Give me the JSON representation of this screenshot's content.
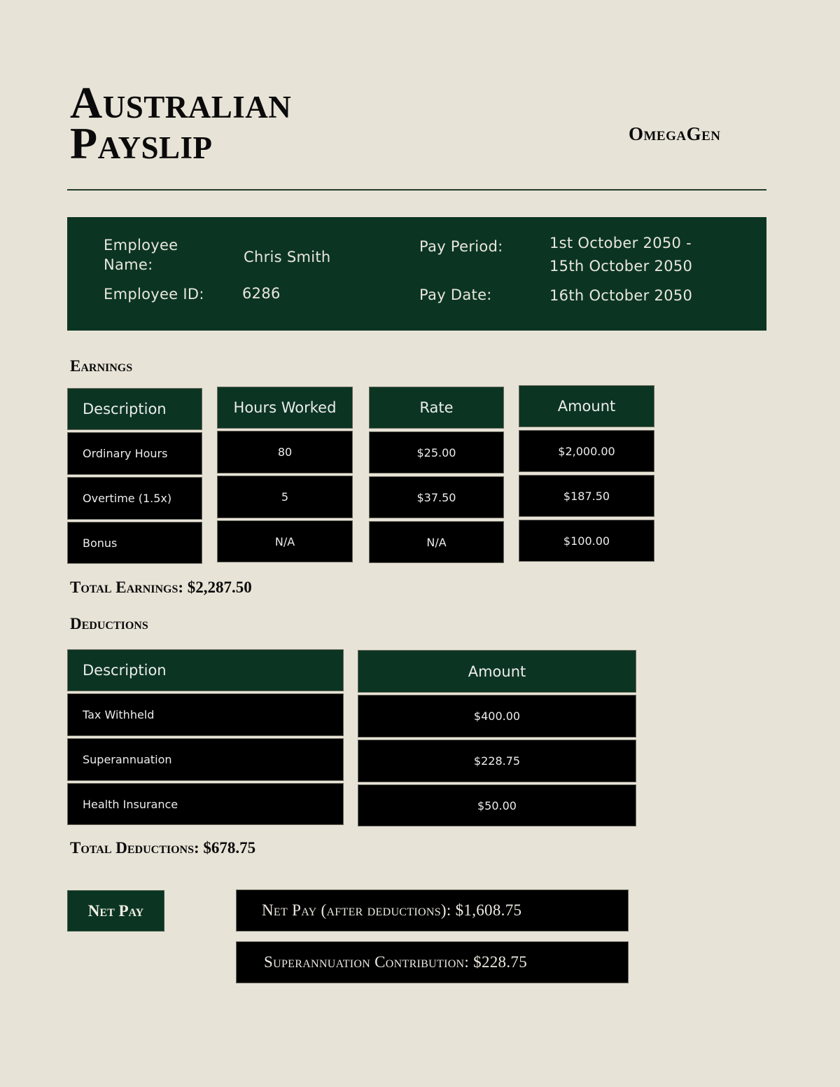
{
  "header": {
    "title_line1": "Australian",
    "title_line2": "Payslip",
    "company": "OmegaGen"
  },
  "employee_info": {
    "name_label": "Employee Name:",
    "name_value": "Chris Smith",
    "id_label": "Employee ID:",
    "id_value": "6286",
    "pay_period_label": "Pay Period:",
    "pay_period_line1": "1st October 2050 -",
    "pay_period_line2": "15th October 2050",
    "pay_date_label": "Pay Date:",
    "pay_date_value": "16th October 2050"
  },
  "earnings": {
    "title": "Earnings",
    "columns": [
      "Description",
      "Hours Worked",
      "Rate",
      "Amount"
    ],
    "rows": [
      [
        "Ordinary Hours",
        "80",
        "$25.00",
        "$2,000.00"
      ],
      [
        "Overtime (1.5x)",
        "5",
        "$37.50",
        "$187.50"
      ],
      [
        "Bonus",
        "N/A",
        "N/A",
        "$100.00"
      ]
    ],
    "total": "Total Earnings: $2,287.50"
  },
  "deductions": {
    "title": "Deductions",
    "columns": [
      "Description",
      "Amount"
    ],
    "rows": [
      [
        "Tax Withheld",
        "$400.00"
      ],
      [
        "Superannuation",
        "$228.75"
      ],
      [
        "Health Insurance",
        "$50.00"
      ]
    ],
    "total": "Total Deductions: $678.75"
  },
  "net_pay": {
    "label": "Net Pay",
    "net_pay_text": "Net Pay (after deductions): $1,608.75",
    "super_text": "Superannuation Contribution: $228.75"
  },
  "colors": {
    "background": "#e8e3d7",
    "accent_green": "#0b3522",
    "cell_black": "#000000"
  }
}
